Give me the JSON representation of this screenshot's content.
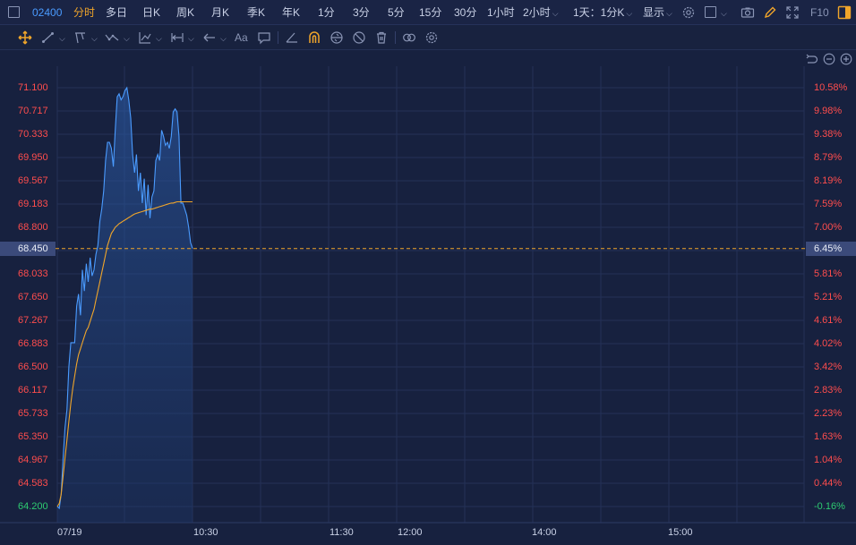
{
  "toolbar": {
    "code": "02400",
    "periods": [
      "分时",
      "多日",
      "日K",
      "周K",
      "月K",
      "季K",
      "年K",
      "1分",
      "3分",
      "5分",
      "15分",
      "30分",
      "1小时",
      "2小时"
    ],
    "active_period": "分时",
    "interval": "1天：1分K",
    "display": "显示",
    "f10": "F10"
  },
  "drawing_tools": {
    "text_tool": "Aa",
    "icons": [
      "move-icon",
      "line-tool-icon",
      "channel-tool-icon",
      "wave-tool-icon",
      "fib-tool-icon",
      "range-tool-icon",
      "arrow-tool-icon",
      "text-tool-icon",
      "comment-tool-icon",
      "angle-icon",
      "magnet-icon",
      "lock-icon",
      "hide-icon",
      "delete-icon",
      "link-icon",
      "settings-icon"
    ]
  },
  "chart_controls": [
    "undo-icon",
    "zoom-out-icon",
    "zoom-in-icon"
  ],
  "colors": {
    "background": "#17213f",
    "price_line": "#4a9bff",
    "avg_line": "#f0a52a",
    "up": "#ff4d4d",
    "down": "#2ecc71",
    "accent": "#f0a52a"
  },
  "current": {
    "price_label": "68.450",
    "pct_label": "6.45%"
  },
  "chart_data": {
    "type": "line",
    "x_ticks": [
      "07/19",
      "10:30",
      "11:30",
      "12:00",
      "14:00",
      "15:00"
    ],
    "y_ticks_price": [
      "71.100",
      "70.717",
      "70.333",
      "69.950",
      "69.567",
      "69.183",
      "68.800",
      "68.450",
      "68.033",
      "67.650",
      "67.267",
      "66.883",
      "66.500",
      "66.117",
      "65.733",
      "65.350",
      "64.967",
      "64.583",
      "64.200"
    ],
    "y_ticks_pct": [
      "10.58%",
      "9.98%",
      "9.38%",
      "8.79%",
      "8.19%",
      "7.59%",
      "7.00%",
      "6.45%",
      "5.81%",
      "5.21%",
      "4.61%",
      "4.02%",
      "3.42%",
      "2.83%",
      "2.23%",
      "1.63%",
      "1.04%",
      "0.44%",
      "-0.16%"
    ],
    "ylim": [
      64.2,
      71.1
    ],
    "baseline_price": 64.3,
    "series": [
      {
        "values": [
          64.2,
          64.17,
          64.4,
          65.0,
          65.5,
          65.8,
          66.5,
          66.9,
          66.9,
          66.9,
          67.5,
          67.7,
          67.35,
          68.1,
          67.75,
          68.2,
          67.9,
          68.3,
          68.0,
          68.1,
          68.35,
          68.5,
          68.9,
          69.1,
          69.4,
          69.9,
          70.2,
          70.2,
          70.1,
          69.8,
          70.4,
          70.95,
          71.0,
          70.9,
          70.95,
          71.05,
          71.1,
          70.9,
          70.6,
          70.0,
          69.7,
          70.0,
          69.4,
          69.7,
          69.2,
          69.6,
          69.0,
          69.5,
          68.95,
          69.3,
          69.4,
          69.9,
          70.0,
          69.9,
          70.4,
          70.3,
          70.15,
          70.2,
          70.1,
          70.3,
          70.7,
          70.75,
          70.7,
          70.3,
          69.2,
          69.2,
          69.1,
          69.0,
          68.8,
          68.55,
          68.45
        ],
        "color": "#4a9bff"
      },
      {
        "values": [
          64.2,
          64.25,
          64.4,
          64.7,
          65.0,
          65.3,
          65.6,
          65.9,
          66.15,
          66.35,
          66.55,
          66.7,
          66.8,
          66.9,
          67.0,
          67.1,
          67.15,
          67.25,
          67.35,
          67.45,
          67.6,
          67.75,
          67.9,
          68.05,
          68.2,
          68.35,
          68.5,
          68.6,
          68.7,
          68.75,
          68.8,
          68.83,
          68.86,
          68.88,
          68.9,
          68.92,
          68.94,
          68.96,
          68.98,
          69.0,
          69.02,
          69.03,
          69.04,
          69.05,
          69.06,
          69.07,
          69.08,
          69.09,
          69.1,
          69.1,
          69.11,
          69.12,
          69.13,
          69.14,
          69.15,
          69.16,
          69.17,
          69.18,
          69.19,
          69.2,
          69.2,
          69.21,
          69.22,
          69.22,
          69.22,
          69.22,
          69.22,
          69.22,
          69.22,
          69.22,
          69.22
        ],
        "color": "#f0a52a"
      }
    ],
    "current_price": 68.45
  }
}
